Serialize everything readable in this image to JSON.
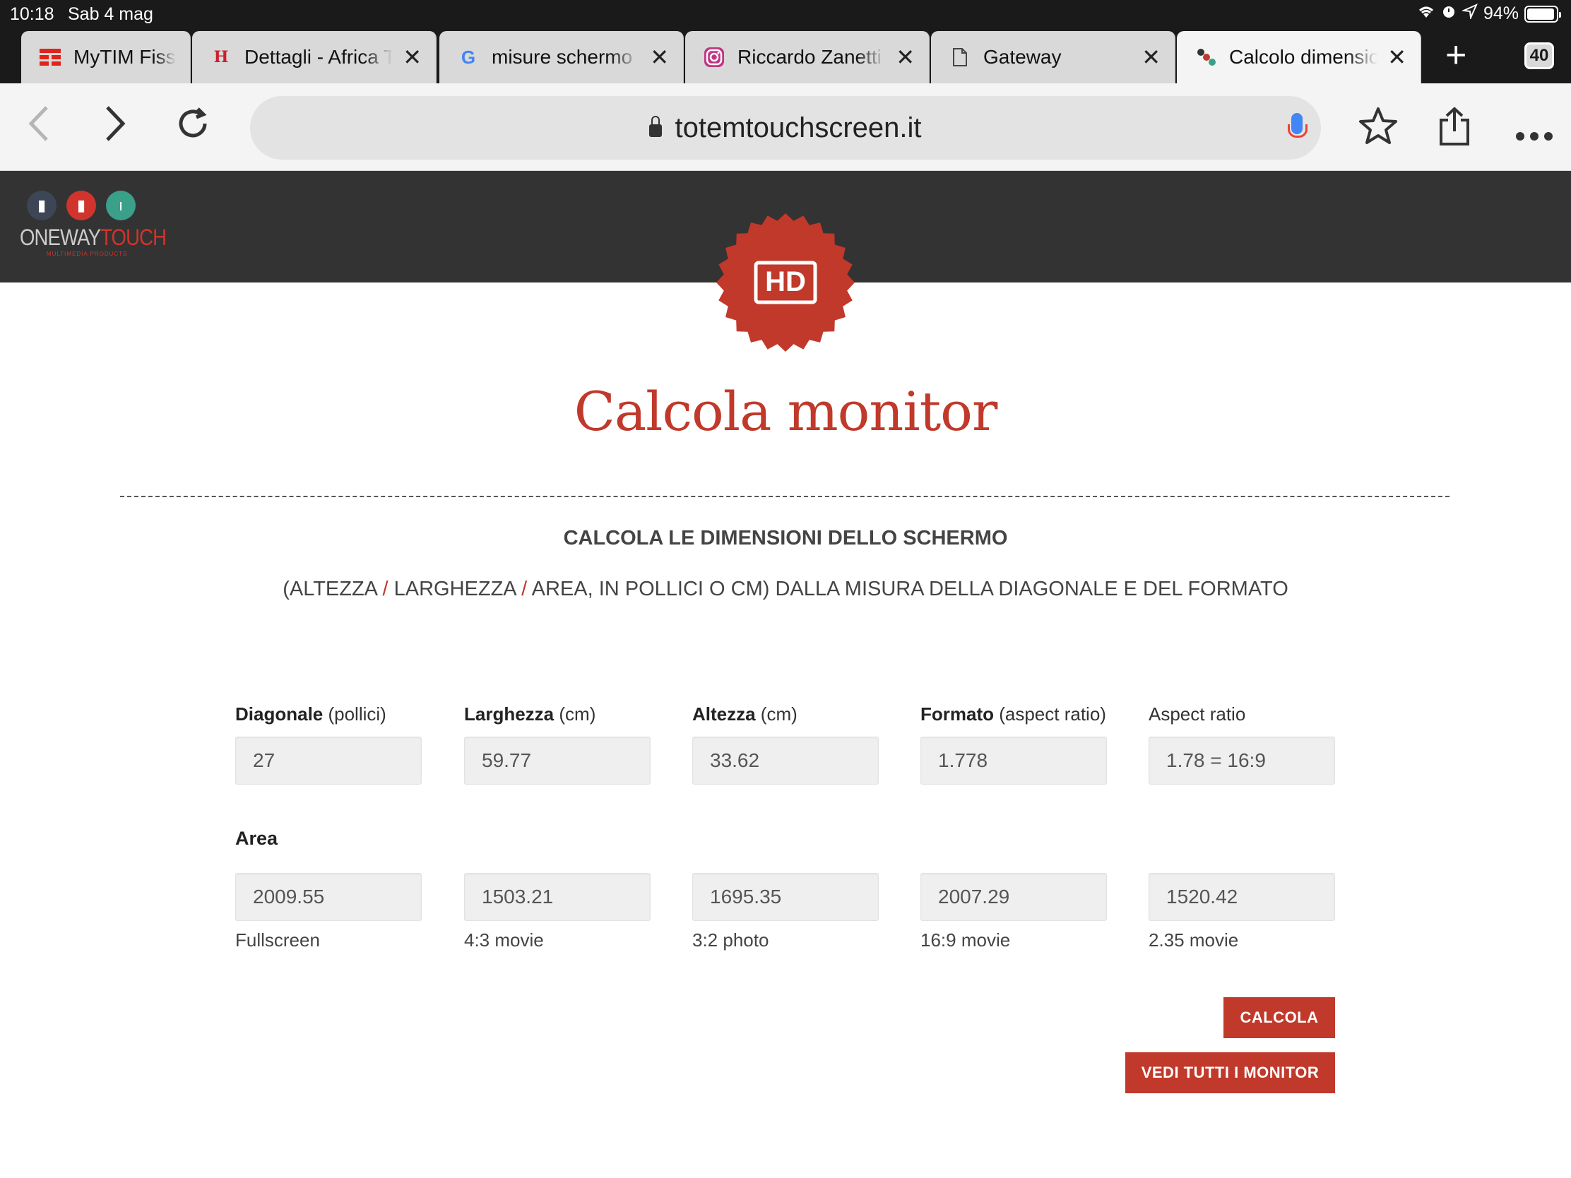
{
  "status": {
    "time": "10:18",
    "date": "Sab 4 mag",
    "battery": "94%",
    "battery_level": 0.94
  },
  "tabs": [
    {
      "title": "MyTIM Fiss",
      "icon": "tim-logo-icon",
      "color": "#e2231a",
      "left": 0
    },
    {
      "title": "Dettagli - Africa T",
      "icon": "hotel-logo-icon",
      "color": "#cc1f2f"
    },
    {
      "title": "misure schermo",
      "icon": "google-g-icon",
      "color": "#4285f4"
    },
    {
      "title": "Riccardo Zanetti",
      "icon": "instagram-icon",
      "color": "#c13584"
    },
    {
      "title": "Gateway",
      "icon": "document-icon",
      "color": "#555555"
    },
    {
      "title": "Calcolo dimensio",
      "icon": "site-favicon-icon",
      "color": "#c0392b"
    }
  ],
  "tab_count": "40",
  "url": "totemtouchscreen.it",
  "brand": {
    "name_gray": "ONEWAY",
    "name_red": "TOUCH",
    "tagline": "MULTIMEDIA PRODUCTS"
  },
  "badge_text": "HD",
  "page_title": "Calcola monitor",
  "subtitle": "CALCOLA LE DIMENSIONI DELLO SCHERMO",
  "desc": {
    "p1": "(ALTEZZA ",
    "sep": "/",
    "p2": " LARGHEZZA ",
    "p3": " AREA, IN POLLICI O CM) DALLA MISURA DELLA DIAGONALE E DEL FORMATO"
  },
  "fields": [
    {
      "bold": "Diagonale",
      "unit": " (pollici)",
      "value": "27"
    },
    {
      "bold": "Larghezza",
      "unit": " (cm)",
      "value": "59.77"
    },
    {
      "bold": "Altezza",
      "unit": " (cm)",
      "value": "33.62"
    },
    {
      "bold": "Formato",
      "unit": " (aspect ratio)",
      "value": "1.778"
    },
    {
      "bold": "",
      "unit": "Aspect ratio",
      "value": "1.78 = 16:9"
    }
  ],
  "area_label": "Area",
  "areas": [
    {
      "value": "2009.55",
      "caption": "Fullscreen"
    },
    {
      "value": "1503.21",
      "caption": "4:3 movie"
    },
    {
      "value": "1695.35",
      "caption": "3:2 photo"
    },
    {
      "value": "2007.29",
      "caption": "16:9 movie"
    },
    {
      "value": "1520.42",
      "caption": "2.35 movie"
    }
  ],
  "buttons": {
    "calcola": "CALCOLA",
    "vedi": "VEDI TUTTI I MONITOR"
  }
}
